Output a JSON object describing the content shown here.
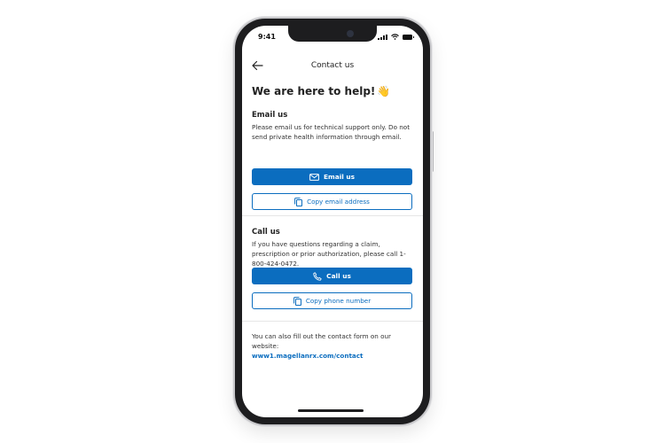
{
  "status_bar": {
    "time": "9:41"
  },
  "header": {
    "title": "Contact us"
  },
  "intro": {
    "heading": "We are here to help!",
    "emoji": "👋"
  },
  "email_section": {
    "title": "Email us",
    "description": "Please email us for technical support only. Do not send private health information through email.",
    "primary_button": "Email us",
    "secondary_button": "Copy email address"
  },
  "call_section": {
    "title": "Call us",
    "description": "If you have questions regarding a claim, prescription or prior authorization, please call 1-800-424-0472.",
    "primary_button": "Call us",
    "secondary_button": "Copy phone number"
  },
  "footer": {
    "text": "You can also fill out the contact form on our website:",
    "link": "www1.magellanrx.com/contact"
  },
  "colors": {
    "accent": "#0b6dbf",
    "frame": "#1d1d1f"
  }
}
